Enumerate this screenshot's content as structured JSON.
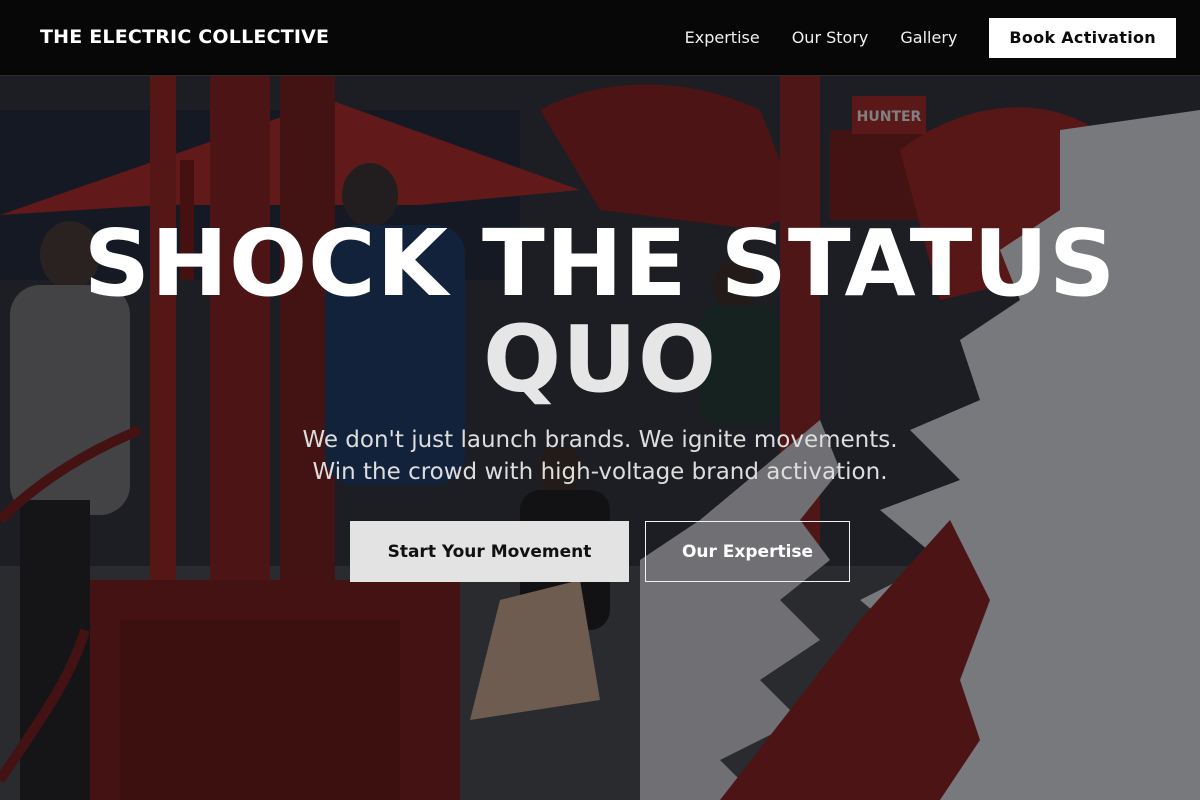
{
  "nav": {
    "brand": "THE ELECTRIC COLLECTIVE",
    "links": [
      "Expertise",
      "Our Story",
      "Gallery"
    ],
    "cta": "Book Activation"
  },
  "hero": {
    "headline_line1": "SHOCK THE STATUS",
    "headline_line2": "QUO",
    "subtitle_line1": "We don't just launch brands. We ignite movements.",
    "subtitle_line2": "Win the crowd with high-voltage brand activation.",
    "primary_button": "Start Your Movement",
    "secondary_button": "Our Expertise"
  },
  "background": {
    "description_icon": "event-photo-background",
    "sign_text": "HUNTER",
    "accent_red": "#8a1f1c",
    "umbrella_red": "#b32a25",
    "white_cutout": "#dfe0e2"
  }
}
